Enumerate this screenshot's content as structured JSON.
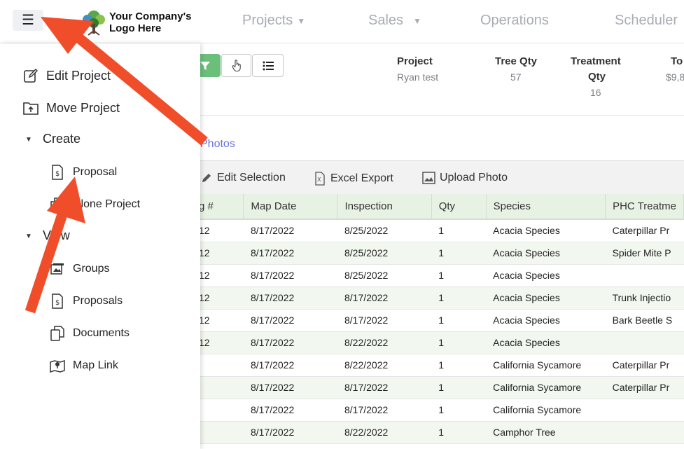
{
  "topbar": {
    "logo_line1": "Your Company's",
    "logo_line2": "Logo Here",
    "nav": [
      {
        "label": "Projects",
        "caret": true
      },
      {
        "label": "Sales",
        "caret": true
      },
      {
        "label": "Operations",
        "caret": false
      },
      {
        "label": "Scheduler",
        "caret": false
      }
    ]
  },
  "summary": {
    "project_label": "Project",
    "project_value": "Ryan test",
    "tree_qty_label": "Tree Qty",
    "tree_qty_value": "57",
    "treatment_label_1": "Treatment",
    "treatment_label_2": "Qty",
    "treatment_value": "16",
    "total_label": "To",
    "total_value": "$9,8"
  },
  "tabs": {
    "photos": "Photos"
  },
  "actions": {
    "edit_selection": "Edit Selection",
    "excel_export": "Excel Export",
    "upload_photo": "Upload Photo"
  },
  "table": {
    "headers": [
      "g #",
      "Map Date",
      "Inspection",
      "Qty",
      "Species",
      "PHC Treatme"
    ],
    "rows": [
      [
        "12",
        "8/17/2022",
        "8/25/2022",
        "1",
        "Acacia Species",
        "Caterpillar Pr"
      ],
      [
        "12",
        "8/17/2022",
        "8/25/2022",
        "1",
        "Acacia Species",
        "Spider Mite P"
      ],
      [
        "12",
        "8/17/2022",
        "8/25/2022",
        "1",
        "Acacia Species",
        ""
      ],
      [
        "12",
        "8/17/2022",
        "8/17/2022",
        "1",
        "Acacia Species",
        "Trunk Injectio"
      ],
      [
        "12",
        "8/17/2022",
        "8/17/2022",
        "1",
        "Acacia Species",
        "Bark Beetle S"
      ],
      [
        "12",
        "8/17/2022",
        "8/22/2022",
        "1",
        "Acacia Species",
        ""
      ],
      [
        "",
        "8/17/2022",
        "8/22/2022",
        "1",
        "California Sycamore",
        "Caterpillar Pr"
      ],
      [
        "",
        "8/17/2022",
        "8/17/2022",
        "1",
        "California Sycamore",
        "Caterpillar Pr"
      ],
      [
        "",
        "8/17/2022",
        "8/17/2022",
        "1",
        "California Sycamore",
        ""
      ],
      [
        "",
        "8/17/2022",
        "8/22/2022",
        "1",
        "Camphor Tree",
        ""
      ]
    ]
  },
  "sidebar": {
    "edit_project": "Edit Project",
    "move_project": "Move Project",
    "create_section": "Create",
    "proposal": "Proposal",
    "clone_project": "Clone Project",
    "view_section": "View",
    "groups": "Groups",
    "proposals": "Proposals",
    "documents": "Documents",
    "map_link": "Map Link"
  },
  "colors": {
    "accent_green": "#6bbf7a",
    "link_blue": "#6674e0",
    "annotation_arrow": "#f04e2a"
  }
}
